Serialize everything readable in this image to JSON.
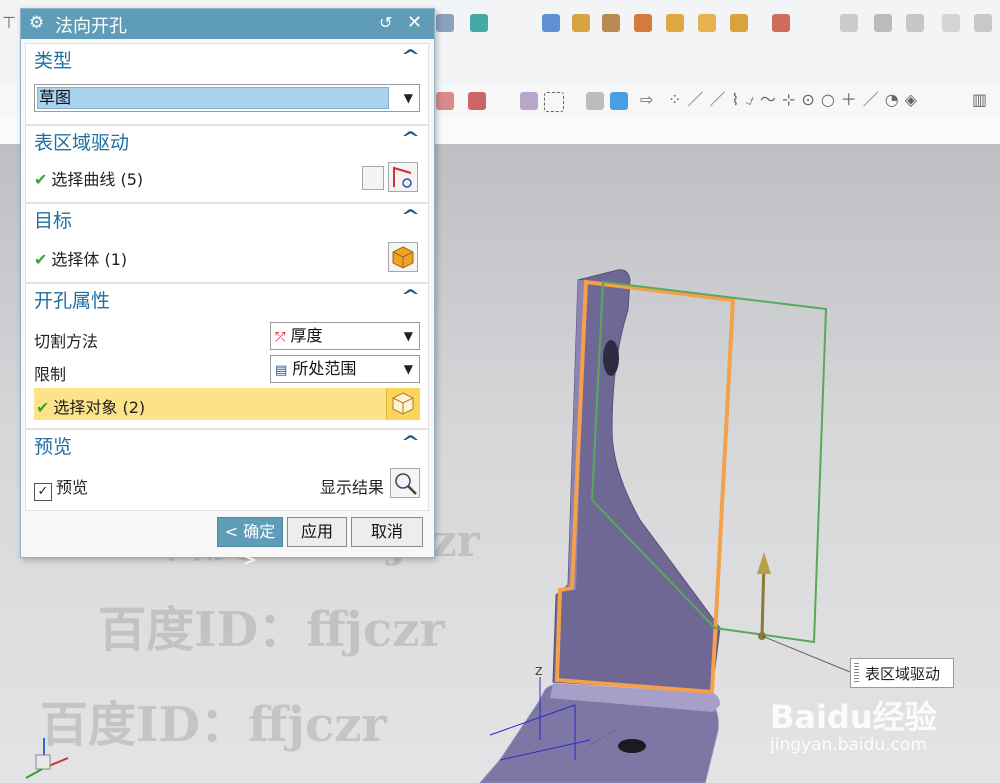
{
  "dialog": {
    "title": "法向开孔",
    "sections": {
      "type": {
        "header": "类型",
        "value": "草图"
      },
      "face_drive": {
        "header": "表区域驱动",
        "select_label": "选择曲线 (5)"
      },
      "target": {
        "header": "目标",
        "select_label": "选择体 (1)"
      },
      "hole_props": {
        "header": "开孔属性",
        "cut_method_label": "切割方法",
        "cut_method_value": "厚度",
        "limit_label": "限制",
        "limit_value": "所处范围",
        "select_objects_label": "选择对象 (2)"
      },
      "preview": {
        "header": "预览",
        "checkbox_label": "预览",
        "show_result_label": "显示结果"
      }
    },
    "buttons": {
      "ok": "< 确定 >",
      "apply": "应用",
      "cancel": "取消"
    }
  },
  "viewport": {
    "callout": "表区域驱动",
    "watermarks": [
      "百度ID：ffjczr",
      "百度ID：ffjczr",
      "百度ID：ffjczr"
    ],
    "logo": "Baidu经验",
    "logo_sub": "jingyan.baidu.com"
  },
  "colors": {
    "dialog_title_bg": "#5f9cb8",
    "header_text": "#1f6fa0",
    "highlight_row": "#fce38a",
    "part_body": "#6f6895",
    "selection_edge": "#f5a04a",
    "sketch_line": "#5aa85a"
  }
}
